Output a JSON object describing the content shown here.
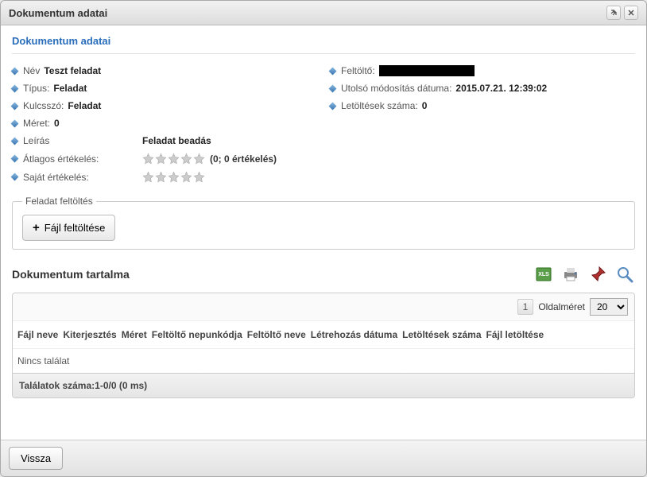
{
  "dialog": {
    "title": "Dokumentum adatai"
  },
  "section": {
    "heading": "Dokumentum adatai"
  },
  "fields": {
    "name_label": "Név",
    "name_value": "Teszt feladat",
    "type_label": "Típus:",
    "type_value": "Feladat",
    "keyword_label": "Kulcsszó:",
    "keyword_value": "Feladat",
    "size_label": "Méret:",
    "size_value": "0",
    "desc_label": "Leírás",
    "desc_value": "Feladat beadás",
    "avg_label": "Átlagos értékelés:",
    "avg_text": "(0; 0 értékelés)",
    "own_label": "Saját értékelés:",
    "uploader_label": "Feltöltő:",
    "lastmod_label": "Utolsó módosítás dátuma:",
    "lastmod_value": "2015.07.21. 12:39:02",
    "downloads_label": "Letöltések száma:",
    "downloads_value": "0"
  },
  "upload": {
    "legend": "Feladat feltöltés",
    "button": "Fájl feltöltése"
  },
  "contents": {
    "title": "Dokumentum tartalma"
  },
  "table": {
    "page_number": "1",
    "pagesize_label": "Oldalméret",
    "pagesize_value": "20",
    "headers": {
      "filename": "Fájl neve",
      "ext": "Kiterjesztés",
      "size": "Méret",
      "uploader_code": "Feltöltő nepunkódja",
      "uploader_name": "Feltöltő neve",
      "created": "Létrehozás dátuma",
      "downloads": "Letöltések száma",
      "download_file": "Fájl letöltése"
    },
    "empty": "Nincs találat",
    "footer": "Találatok száma:1-0/0 (0 ms)"
  },
  "footer": {
    "back": "Vissza"
  }
}
